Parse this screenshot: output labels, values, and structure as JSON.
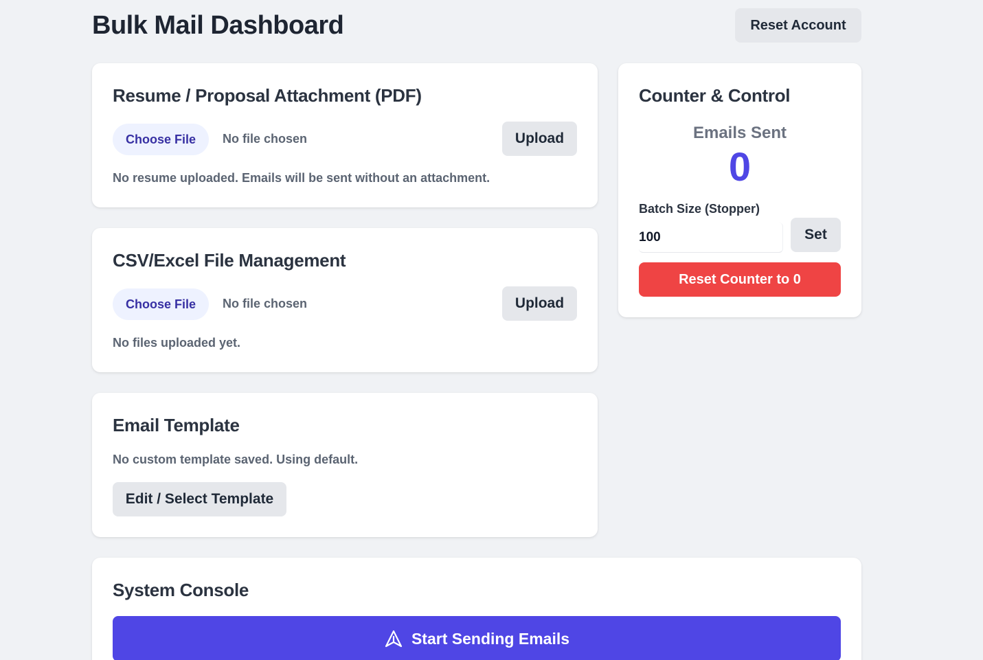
{
  "header": {
    "title": "Bulk Mail Dashboard",
    "reset_account_label": "Reset Account"
  },
  "resume_card": {
    "title": "Resume / Proposal Attachment (PDF)",
    "choose_file_label": "Choose File",
    "file_status": "No file chosen",
    "upload_label": "Upload",
    "note": "No resume uploaded. Emails will be sent without an attachment."
  },
  "csv_card": {
    "title": "CSV/Excel File Management",
    "choose_file_label": "Choose File",
    "file_status": "No file chosen",
    "upload_label": "Upload",
    "note": "No files uploaded yet."
  },
  "template_card": {
    "title": "Email Template",
    "note": "No custom template saved. Using default.",
    "edit_label": "Edit / Select Template"
  },
  "counter_card": {
    "title": "Counter & Control",
    "emails_sent_label": "Emails Sent",
    "emails_sent_value": "0",
    "batch_size_label": "Batch Size (Stopper)",
    "batch_size_value": "100",
    "set_label": "Set",
    "reset_counter_label": "Reset Counter to 0"
  },
  "console_card": {
    "title": "System Console",
    "start_label": "Start Sending Emails",
    "start_icon": "send-icon"
  },
  "colors": {
    "accent": "#4f46e5",
    "danger": "#ef4444",
    "background": "#f0f2f5"
  }
}
